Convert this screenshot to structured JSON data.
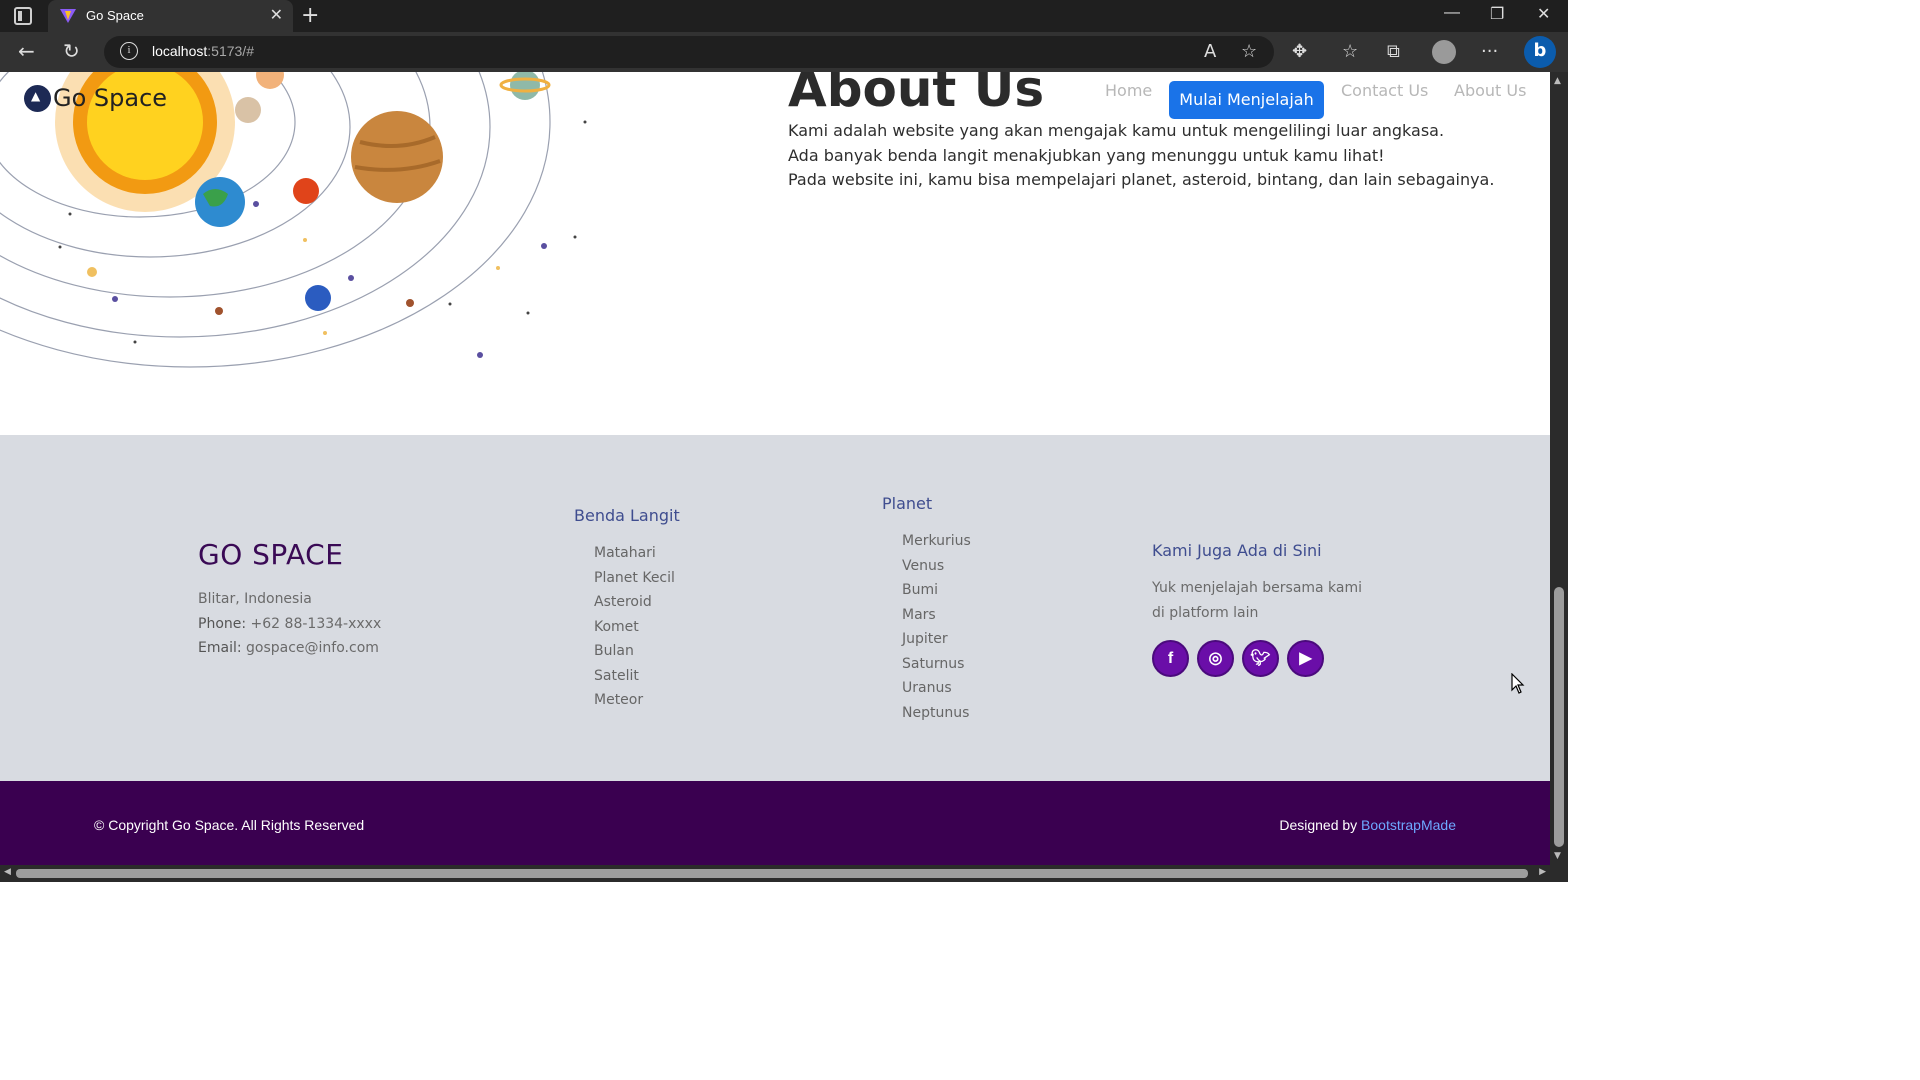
{
  "browser": {
    "tab_title": "Go Space",
    "url_host": "localhost",
    "url_rest": ":5173/#"
  },
  "site": {
    "brand": "Go Space",
    "nav": {
      "home": "Home",
      "explore": "Mulai Menjelajah",
      "contact": "Contact Us",
      "about": "About Us"
    },
    "about": {
      "title": "About Us",
      "lines": [
        "Kami adalah website yang akan mengajak kamu untuk mengelilingi luar angkasa.",
        "Ada banyak benda langit menakjubkan yang menunggu untuk kamu lihat!",
        "Pada website ini, kamu bisa mempelajari planet, asteroid, bintang, dan lain sebagainya."
      ]
    }
  },
  "footer": {
    "brand": "GO SPACE",
    "location": "Blitar, Indonesia",
    "phone_label": "Phone:",
    "phone": "+62 88-1334-xxxx",
    "email_label": "Email:",
    "email": "gospace@info.com",
    "benda": {
      "title": "Benda Langit",
      "items": [
        "Matahari",
        "Planet Kecil",
        "Asteroid",
        "Komet",
        "Bulan",
        "Satelit",
        "Meteor"
      ]
    },
    "planet": {
      "title": "Planet",
      "items": [
        "Merkurius",
        "Venus",
        "Bumi",
        "Mars",
        "Jupiter",
        "Saturnus",
        "Uranus",
        "Neptunus"
      ]
    },
    "social": {
      "title": "Kami Juga Ada di Sini",
      "text": "Yuk menjelajah bersama kami di platform lain",
      "icons": [
        "facebook-icon",
        "instagram-icon",
        "twitter-icon",
        "youtube-icon"
      ]
    },
    "copyright": "© Copyright Go Space. All Rights Reserved",
    "designed_by": "Designed by",
    "designer": "BootstrapMade"
  },
  "colors": {
    "accent_blue": "#1a73e8",
    "footer_dark": "#3a0050",
    "social_purple": "#6a0ea8"
  }
}
